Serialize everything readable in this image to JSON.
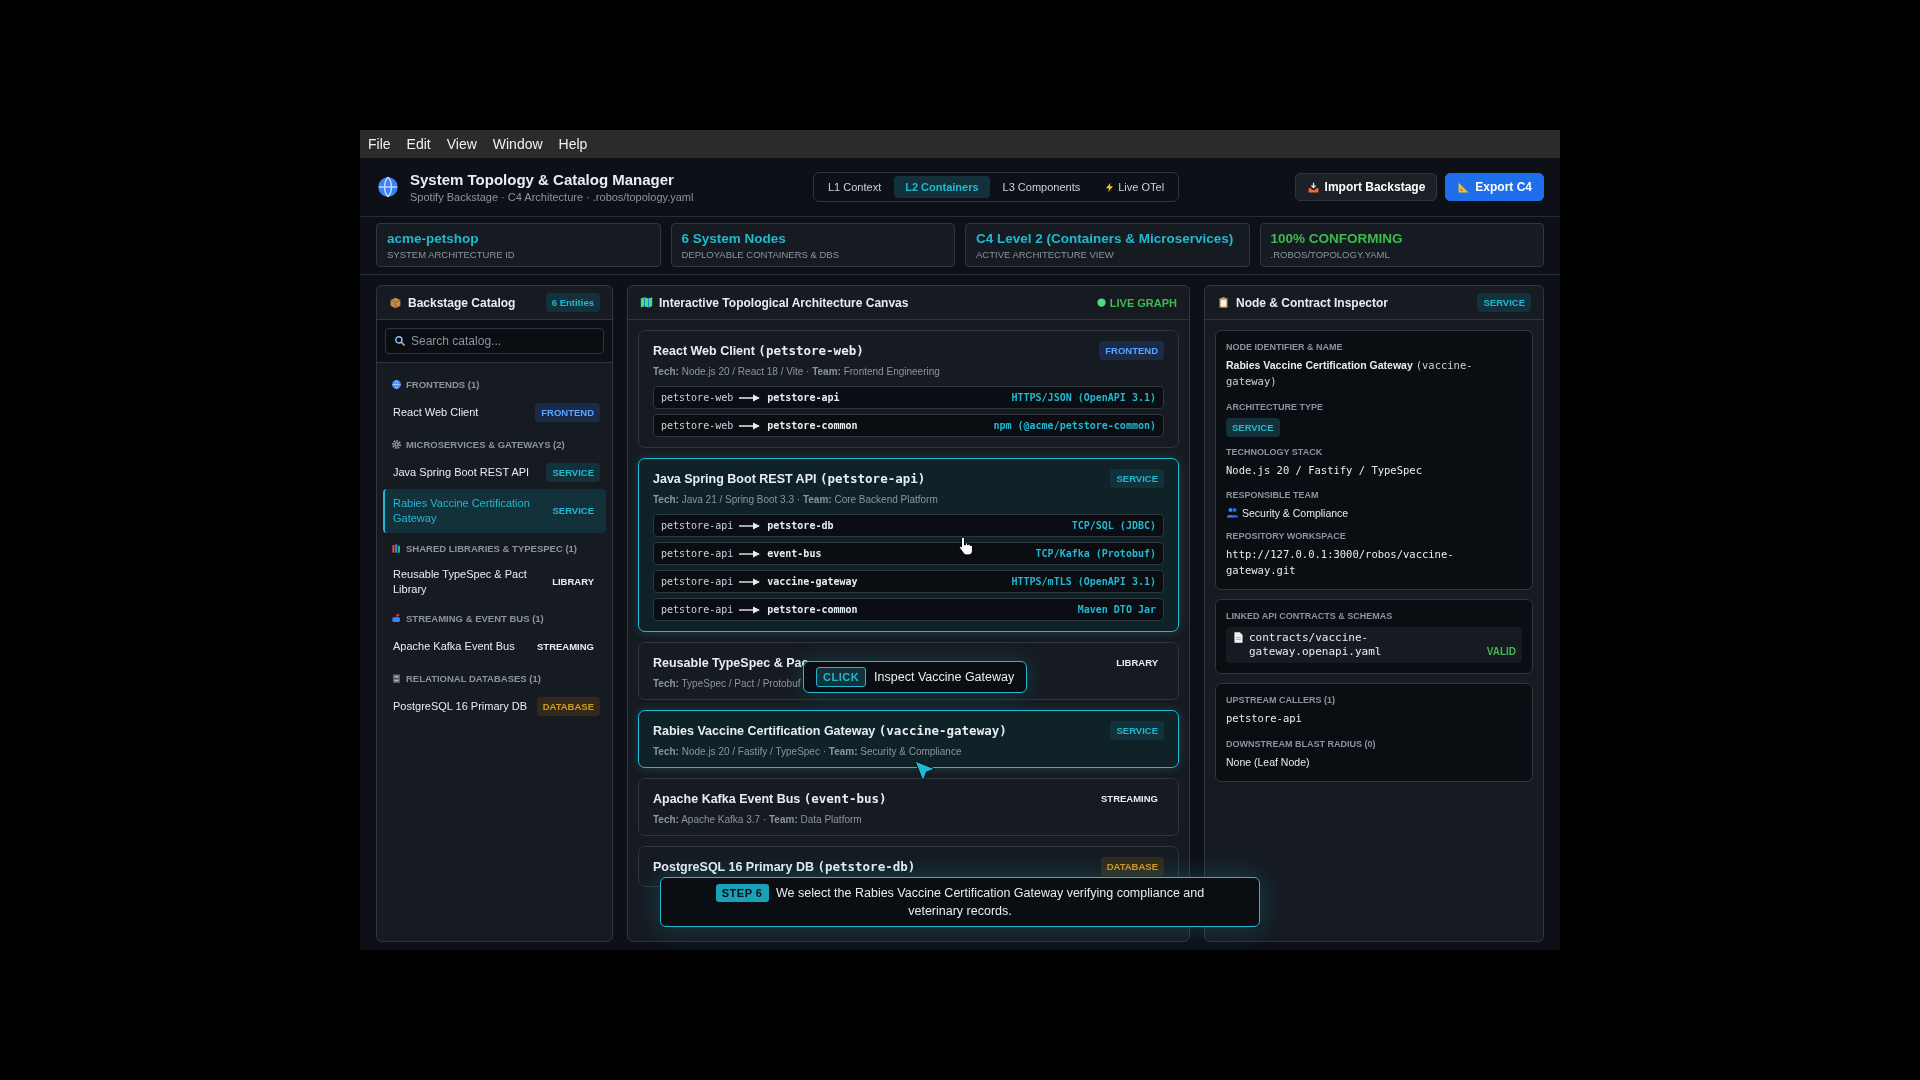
{
  "menu": [
    "File",
    "Edit",
    "View",
    "Window",
    "Help"
  ],
  "app": {
    "title": "System Topology & Catalog Manager",
    "subtitle": "Spotify Backstage · C4 Architecture · .robos/topology.yaml"
  },
  "view_tabs": [
    {
      "label": "L1 Context",
      "selected": false
    },
    {
      "label": "L2 Containers",
      "selected": true
    },
    {
      "label": "L3 Components",
      "selected": false
    },
    {
      "label": "Live OTel",
      "selected": false
    }
  ],
  "actions": [
    {
      "label": "Import Backstage",
      "kind": "secondary"
    },
    {
      "label": "Export C4",
      "kind": "primary"
    }
  ],
  "stats": [
    {
      "value": "acme-petshop",
      "label": "SYSTEM ARCHITECTURE ID",
      "kind": "accent"
    },
    {
      "value": "6 System Nodes",
      "label": "DEPLOYABLE CONTAINERS & DBS",
      "kind": "accent"
    },
    {
      "value": "C4 Level 2 (Containers & Microservices)",
      "label": "ACTIVE ARCHITECTURE VIEW",
      "kind": "accent"
    },
    {
      "value": "100% CONFORMING",
      "label": ".ROBOS/TOPOLOGY.YAML",
      "kind": "success"
    }
  ],
  "catalog": {
    "title": "Backstage Catalog",
    "count": "6 Entities",
    "search": {
      "placeholder": "Search catalog..."
    },
    "groups": [
      {
        "title": "FRONTENDS (1)",
        "items": [
          {
            "name": "React Web Client",
            "type": "FRONTEND",
            "kind": "frontend",
            "selected": false
          }
        ]
      },
      {
        "title": "MICROSERVICES & GATEWAYS (2)",
        "items": [
          {
            "name": "Java Spring Boot REST API",
            "type": "SERVICE",
            "kind": "service",
            "selected": false
          },
          {
            "name": "Rabies Vaccine Certification Gateway",
            "type": "SERVICE",
            "kind": "service",
            "selected": true
          }
        ]
      },
      {
        "title": "SHARED LIBRARIES & TYPESPEC (1)",
        "items": [
          {
            "name": "Reusable TypeSpec & Pact Library",
            "type": "LIBRARY",
            "kind": "library",
            "selected": false
          }
        ]
      },
      {
        "title": "STREAMING & EVENT BUS (1)",
        "items": [
          {
            "name": "Apache Kafka Event Bus",
            "type": "STREAMING",
            "kind": "streaming",
            "selected": false
          }
        ]
      },
      {
        "title": "RELATIONAL DATABASES (1)",
        "items": [
          {
            "name": "PostgreSQL 16 Primary DB",
            "type": "DATABASE",
            "kind": "database",
            "selected": false
          }
        ]
      }
    ]
  },
  "canvas": {
    "title": "Interactive Topological Architecture Canvas",
    "status": "LIVE GRAPH",
    "nodes": [
      {
        "name": "React Web Client",
        "id": "(petstore-web)",
        "type": "FRONTEND",
        "kind": "frontend",
        "selected": false,
        "meta": "**Tech:** Node.js 20 / React 18 / Vite · **Team:** Frontend Engineering",
        "edges": [
          {
            "from": "petstore-web",
            "to": "petstore-api",
            "protocol": "HTTPS/JSON (OpenAPI 3.1)"
          },
          {
            "from": "petstore-web",
            "to": "petstore-common",
            "protocol": "npm (@acme/petstore-common)"
          }
        ]
      },
      {
        "name": "Java Spring Boot REST API",
        "id": "(petstore-api)",
        "type": "SERVICE",
        "kind": "service",
        "selected": true,
        "meta": "**Tech:** Java 21 / Spring Boot 3.3 · **Team:** Core Backend Platform",
        "edges": [
          {
            "from": "petstore-api",
            "to": "petstore-db",
            "protocol": "TCP/SQL (JDBC)"
          },
          {
            "from": "petstore-api",
            "to": "event-bus",
            "protocol": "TCP/Kafka (Protobuf)"
          },
          {
            "from": "petstore-api",
            "to": "vaccine-gateway",
            "protocol": "HTTPS/mTLS (OpenAPI 3.1)"
          },
          {
            "from": "petstore-api",
            "to": "petstore-common",
            "protocol": "Maven DTO Jar"
          }
        ]
      },
      {
        "name": "Reusable TypeSpec & Pac",
        "type": "LIBRARY",
        "kind": "library",
        "selected": false,
        "meta": "**Tech:** TypeSpec / Pact / Protobuf"
      },
      {
        "name": "Rabies Vaccine Certification Gateway",
        "id": "(vaccine-gateway)",
        "type": "SERVICE",
        "kind": "service",
        "selected": true,
        "meta": "**Tech:** Node.js 20 / Fastify / TypeSpec · **Team:** Security & Compliance"
      },
      {
        "name": "Apache Kafka Event Bus",
        "id": "(event-bus)",
        "type": "STREAMING",
        "kind": "streaming",
        "selected": false,
        "meta": "**Tech:** Apache Kafka 3.7 · **Team:** Data Platform"
      },
      {
        "name": "PostgreSQL 16 Primary DB",
        "id": "(petstore-db)",
        "type": "DATABASE",
        "kind": "database",
        "selected": false
      }
    ]
  },
  "inspector": {
    "title": "Node & Contract Inspector",
    "badge": {
      "label": "SERVICE",
      "kind": "service"
    },
    "identity": {
      "label": "NODE IDENTIFIER & NAME",
      "name": "Rabies Vaccine Certification Gateway",
      "id": "(vaccine-gateway)"
    },
    "arch": {
      "label": "ARCHITECTURE TYPE",
      "badge": {
        "label": "SERVICE",
        "kind": "service"
      }
    },
    "stack": {
      "label": "TECHNOLOGY STACK",
      "value": "Node.js 20 / Fastify / TypeSpec"
    },
    "team": {
      "label": "RESPONSIBLE TEAM",
      "value": "Security & Compliance"
    },
    "repo": {
      "label": "REPOSITORY WORKSPACE",
      "value": "http://127.0.0.1:3000/robos/vaccine-gateway.git"
    },
    "contracts": {
      "label": "LINKED API CONTRACTS & SCHEMAS",
      "file": "contracts/vaccine-gateway.openapi.yaml",
      "status": "VALID"
    },
    "upstream": {
      "label": "UPSTREAM CALLERS (1)",
      "value": "petstore-api"
    },
    "downstream": {
      "label": "DOWNSTREAM BLAST RADIUS (0)",
      "value": "None (Leaf Node)"
    }
  },
  "tooltip": {
    "tag": "CLICK",
    "text": "Inspect Vaccine Gateway"
  },
  "step": {
    "tag": "STEP 6",
    "text": "We select the Rabies Vaccine Certification Gateway verifying compliance and veterinary records."
  }
}
